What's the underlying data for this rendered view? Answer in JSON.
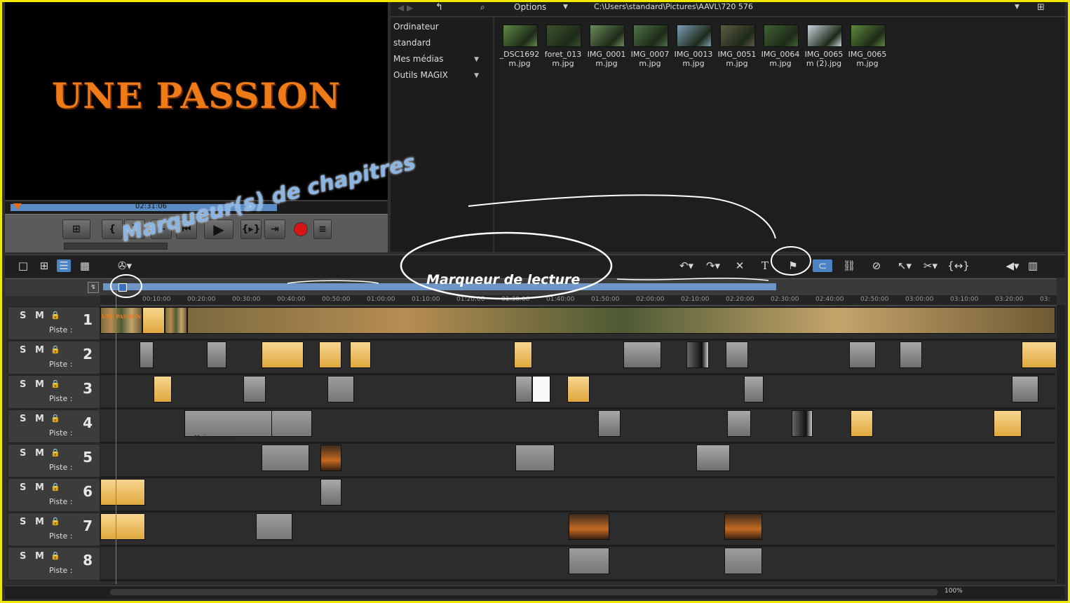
{
  "preview": {
    "title": "UNE PASSION",
    "timecode": "02:31:06"
  },
  "media_pool": {
    "options_label": "Options",
    "path": "C:\\Users\\standard\\Pictures\\AAVL\\720 576",
    "nav": [
      {
        "label": "Ordinateur",
        "arrow": ""
      },
      {
        "label": "standard",
        "arrow": ""
      },
      {
        "label": "Mes médias",
        "arrow": "▼"
      },
      {
        "label": "Outils MAGIX",
        "arrow": "▼"
      }
    ],
    "thumbnails": [
      {
        "line1": "_DSC1692",
        "line2": "m.jpg",
        "color": "#5f8a45"
      },
      {
        "line1": "foret_013",
        "line2": "m.jpg",
        "color": "#3c5230"
      },
      {
        "line1": "IMG_0001",
        "line2": "m.jpg",
        "color": "#6c8c5a"
      },
      {
        "line1": "IMG_0007",
        "line2": "m.jpg",
        "color": "#4f7248"
      },
      {
        "line1": "IMG_0013",
        "line2": "m.jpg",
        "color": "#7d9fb8"
      },
      {
        "line1": "IMG_0051",
        "line2": "m.jpg",
        "color": "#5d5a45"
      },
      {
        "line1": "IMG_0064",
        "line2": "m.jpg",
        "color": "#3f6232"
      },
      {
        "line1": "IMG_0065",
        "line2": "m (2).jpg",
        "color": "#c9d4de"
      },
      {
        "line1": "IMG_0065",
        "line2": "m.jpg",
        "color": "#5e8a3c"
      }
    ]
  },
  "ruler": [
    "00:10:00",
    "00:20:00",
    "00:30:00",
    "00:40:00",
    "00:50:00",
    "01:00:00",
    "01:10:00",
    "01:20:00",
    "01:30:00",
    "01:40:00",
    "01:50:00",
    "02:00:00",
    "02:10:00",
    "02:20:00",
    "02:30:00",
    "02:40:00",
    "02:50:00",
    "03:00:00",
    "03:10:00",
    "03:20:00",
    "03:"
  ],
  "tracks": [
    {
      "s": "S",
      "m": "M",
      "piste": "Piste :",
      "num": "1"
    },
    {
      "s": "S",
      "m": "M",
      "piste": "Piste :",
      "num": "2"
    },
    {
      "s": "S",
      "m": "M",
      "piste": "Piste :",
      "num": "3"
    },
    {
      "s": "S",
      "m": "M",
      "piste": "Piste :",
      "num": "4"
    },
    {
      "s": "S",
      "m": "M",
      "piste": "Piste :",
      "num": "5"
    },
    {
      "s": "S",
      "m": "M",
      "piste": "Piste :",
      "num": "6"
    },
    {
      "s": "S",
      "m": "M",
      "piste": "Piste :",
      "num": "7"
    },
    {
      "s": "S",
      "m": "M",
      "piste": "Piste :",
      "num": "8"
    }
  ],
  "clips": {
    "track1_title": "UNE PASSION",
    "wav_label": "Moineau.wav"
  },
  "zoom": "100%",
  "annotations": {
    "chapters": "Marqueur(s) de chapitres",
    "playback": "Marqueur de lecture"
  },
  "colors": {
    "accent_orange": "#ef7a18",
    "selection_blue": "#6e95c8",
    "frame_yellow": "#f1e900",
    "record_red": "#d81515"
  }
}
